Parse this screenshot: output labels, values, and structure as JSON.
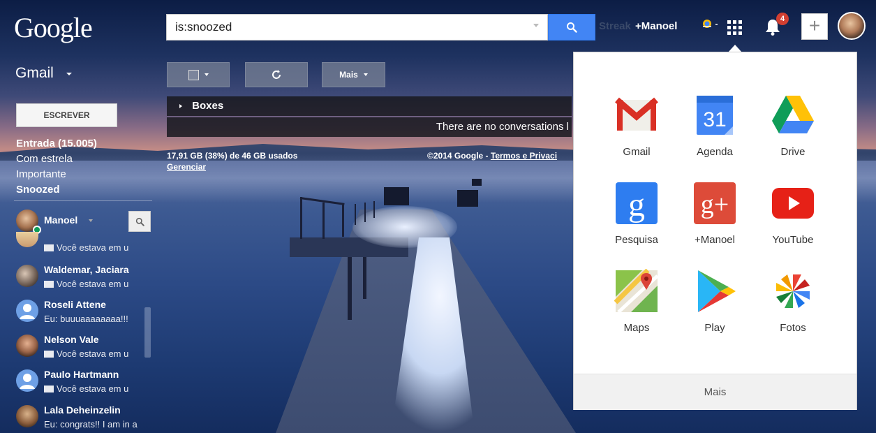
{
  "header": {
    "logo": "Google",
    "search_value": "is:snoozed",
    "streak_label": "Streak",
    "profile_link": "+Manoel",
    "notifications_count": "4",
    "share_label": "+"
  },
  "toolbar": {
    "gmail_label": "Gmail",
    "more_label": "Mais",
    "boxes_label": "Boxes",
    "empty_message": "There are no conversations l",
    "storage_text": "17,91 GB (38%) de 46 GB usados",
    "manage_link": "Gerenciar",
    "copyright_text": "©2014 Google - ",
    "terms_link": "Termos e Privaci"
  },
  "sidebar": {
    "compose_label": "ESCREVER",
    "items": [
      {
        "label": "Entrada (15.005)",
        "bold": true
      },
      {
        "label": "Com estrela",
        "bold": false
      },
      {
        "label": "Importante",
        "bold": false
      },
      {
        "label": "Snoozed",
        "bold": true
      }
    ]
  },
  "chat": {
    "me": "Manoel",
    "contacts": [
      {
        "name": "",
        "status": "Você estava em u"
      },
      {
        "name": "Waldemar, Jaciara",
        "status": "Você estava em u"
      },
      {
        "name": "Roseli Attene",
        "status": "Eu: buuuaaaaaaaa!!!"
      },
      {
        "name": "Nelson Vale",
        "status": "Você estava em u"
      },
      {
        "name": "Paulo Hartmann",
        "status": "Você estava em u"
      },
      {
        "name": "Lala Deheinzelin",
        "status": "Eu: congrats!! I am in a"
      }
    ]
  },
  "apps": {
    "items": [
      {
        "label": "Gmail",
        "icon": "gmail-icon"
      },
      {
        "label": "Agenda",
        "icon": "calendar-icon",
        "badge": "31"
      },
      {
        "label": "Drive",
        "icon": "drive-icon"
      },
      {
        "label": "Pesquisa",
        "icon": "google-search-icon",
        "badge": "g"
      },
      {
        "label": "+Manoel",
        "icon": "google-plus-icon",
        "badge": "g+"
      },
      {
        "label": "YouTube",
        "icon": "youtube-icon"
      },
      {
        "label": "Maps",
        "icon": "maps-icon"
      },
      {
        "label": "Play",
        "icon": "play-store-icon"
      },
      {
        "label": "Fotos",
        "icon": "photos-icon"
      }
    ],
    "more_label": "Mais"
  },
  "colors": {
    "search_blue": "#4285f4",
    "gmail_red": "#d93025",
    "youtube_red": "#e62117",
    "plus_red": "#dd4b39"
  }
}
